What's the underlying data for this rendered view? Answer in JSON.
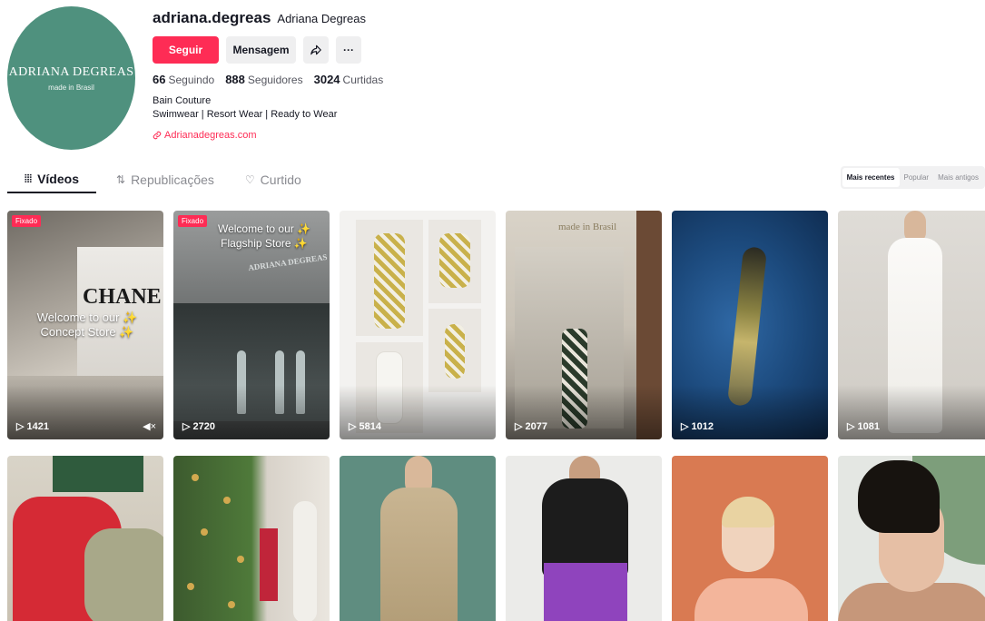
{
  "profile": {
    "avatar_brand": "ADRIANA DEGREAS",
    "avatar_tagline": "made in Brasil",
    "username": "adriana.degreas",
    "nickname": "Adriana Degreas",
    "follow_label": "Seguir",
    "message_label": "Mensagem",
    "share_icon": "share-icon",
    "more_icon": "more-icon",
    "stats": {
      "following_count": "66",
      "following_label": "Seguindo",
      "followers_count": "888",
      "followers_label": "Seguidores",
      "likes_count": "3024",
      "likes_label": "Curtidas"
    },
    "bio_line1": "Bain Couture",
    "bio_line2": "Swimwear | Resort Wear | Ready to Wear",
    "link_text": "Adrianadegreas.com"
  },
  "tabs": [
    {
      "label": "Vídeos",
      "icon": "grid-icon",
      "active": true
    },
    {
      "label": "Republicações",
      "icon": "repost-icon",
      "active": false
    },
    {
      "label": "Curtido",
      "icon": "heart-icon",
      "active": false
    }
  ],
  "sort": {
    "options": [
      "Mais recentes",
      "Popular",
      "Mais antigos"
    ],
    "selected": "Mais recentes"
  },
  "videos": [
    {
      "views": "1421",
      "pinned_label": "Fixado",
      "overlay": "Welcome to our ✨ Concept Store ✨",
      "sign": "CHANE",
      "muted_icon": "mute-icon"
    },
    {
      "views": "2720",
      "pinned_label": "Fixado",
      "overlay": "Welcome to our ✨ Flagship Store ✨",
      "sign": "ADRIANA DEGREAS"
    },
    {
      "views": "5814"
    },
    {
      "views": "2077",
      "sign": "made in Brasil"
    },
    {
      "views": "1012"
    },
    {
      "views": "1081"
    },
    {},
    {},
    {},
    {},
    {},
    {}
  ],
  "colors": {
    "accent": "#fe2c55",
    "avatar_bg": "#4f917e",
    "text": "#161823",
    "muted": "#8a8b91"
  }
}
